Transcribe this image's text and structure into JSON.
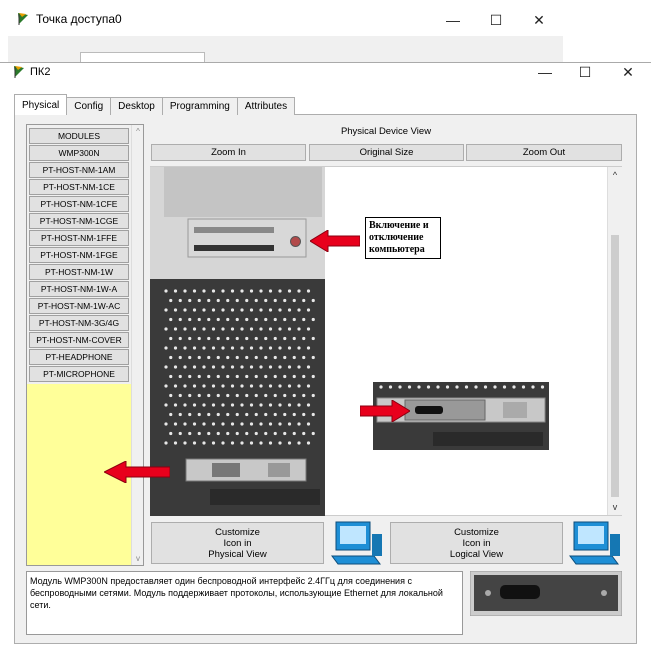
{
  "back_window": {
    "title": "Точка доступа0"
  },
  "window": {
    "title": "ПК2"
  },
  "window_controls": {
    "minimize": "—",
    "maximize": "☐",
    "close": "✕"
  },
  "tabs": [
    {
      "label": "Physical",
      "active": true
    },
    {
      "label": "Config",
      "active": false
    },
    {
      "label": "Desktop",
      "active": false
    },
    {
      "label": "Programming",
      "active": false
    },
    {
      "label": "Attributes",
      "active": false
    }
  ],
  "modules": {
    "header": "MODULES",
    "items": [
      "WMP300N",
      "PT-HOST-NM-1AM",
      "PT-HOST-NM-1CE",
      "PT-HOST-NM-1CFE",
      "PT-HOST-NM-1CGE",
      "PT-HOST-NM-1FFE",
      "PT-HOST-NM-1FGE",
      "PT-HOST-NM-1W",
      "PT-HOST-NM-1W-A",
      "PT-HOST-NM-1W-AC",
      "PT-HOST-NM-3G/4G",
      "PT-HOST-NM-COVER",
      "PT-HEADPHONE",
      "PT-MICROPHONE"
    ]
  },
  "device_view": {
    "title": "Physical Device View",
    "zoom_in": "Zoom In",
    "original_size": "Original Size",
    "zoom_out": "Zoom Out",
    "power_note": "Включение и отключение компьютера"
  },
  "customize": {
    "physical": [
      "Customize",
      "Icon in",
      "Physical View"
    ],
    "logical": [
      "Customize",
      "Icon in",
      "Logical View"
    ]
  },
  "description": "Модуль WMP300N предоставляет один беспроводной интерфейс 2.4ГГц для соединения с беспроводными сетями. Модуль поддерживает протоколы, использующие Ethernet для локальной сети.",
  "colors": {
    "module_bg": "#ffff99",
    "arrow": "#e8001c",
    "pc_case": "#3a3a3a"
  }
}
